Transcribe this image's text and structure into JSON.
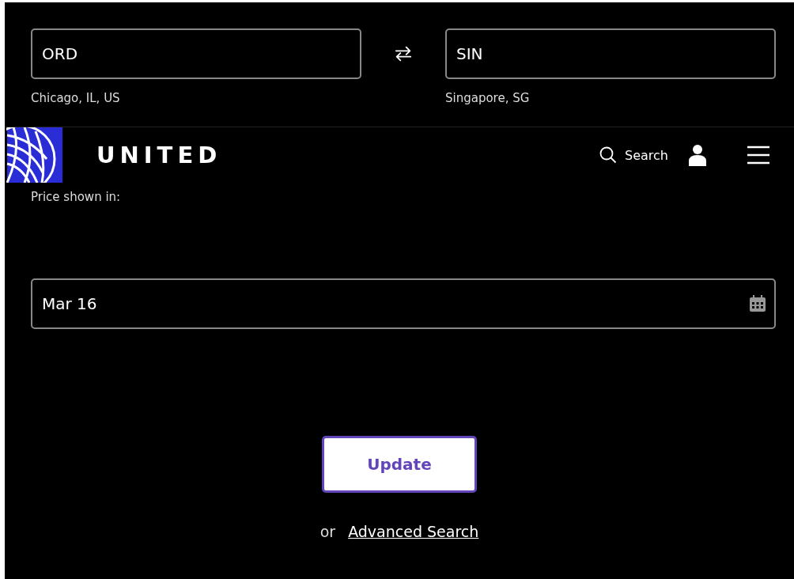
{
  "origin": {
    "value": "ORD",
    "city": "Chicago, IL, US"
  },
  "destination": {
    "value": "SIN",
    "city": "Singapore, SG"
  },
  "header": {
    "brand": "UNITED",
    "search": "Search"
  },
  "price_label": "Price shown in:",
  "date": {
    "value": "Mar 16"
  },
  "update_button": "Update",
  "or_text": "or",
  "advanced_link": "Advanced Search"
}
